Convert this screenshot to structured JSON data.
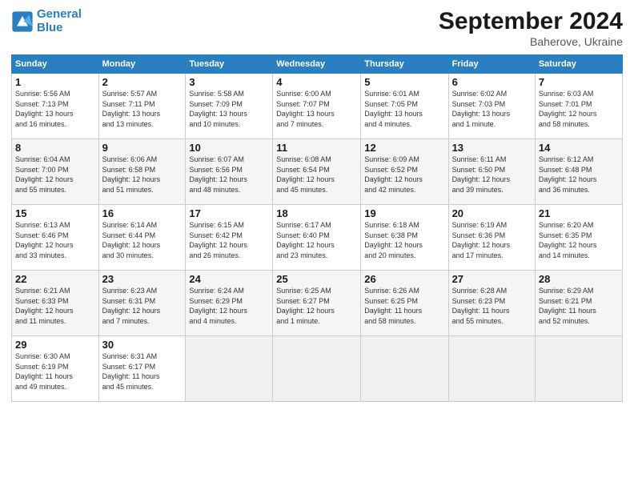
{
  "logo": {
    "line1": "General",
    "line2": "Blue"
  },
  "title": "September 2024",
  "subtitle": "Baherove, Ukraine",
  "days_header": [
    "Sunday",
    "Monday",
    "Tuesday",
    "Wednesday",
    "Thursday",
    "Friday",
    "Saturday"
  ],
  "weeks": [
    [
      {
        "num": "1",
        "info": "Sunrise: 5:56 AM\nSunset: 7:13 PM\nDaylight: 13 hours\nand 16 minutes."
      },
      {
        "num": "2",
        "info": "Sunrise: 5:57 AM\nSunset: 7:11 PM\nDaylight: 13 hours\nand 13 minutes."
      },
      {
        "num": "3",
        "info": "Sunrise: 5:58 AM\nSunset: 7:09 PM\nDaylight: 13 hours\nand 10 minutes."
      },
      {
        "num": "4",
        "info": "Sunrise: 6:00 AM\nSunset: 7:07 PM\nDaylight: 13 hours\nand 7 minutes."
      },
      {
        "num": "5",
        "info": "Sunrise: 6:01 AM\nSunset: 7:05 PM\nDaylight: 13 hours\nand 4 minutes."
      },
      {
        "num": "6",
        "info": "Sunrise: 6:02 AM\nSunset: 7:03 PM\nDaylight: 13 hours\nand 1 minute."
      },
      {
        "num": "7",
        "info": "Sunrise: 6:03 AM\nSunset: 7:01 PM\nDaylight: 12 hours\nand 58 minutes."
      }
    ],
    [
      {
        "num": "8",
        "info": "Sunrise: 6:04 AM\nSunset: 7:00 PM\nDaylight: 12 hours\nand 55 minutes."
      },
      {
        "num": "9",
        "info": "Sunrise: 6:06 AM\nSunset: 6:58 PM\nDaylight: 12 hours\nand 51 minutes."
      },
      {
        "num": "10",
        "info": "Sunrise: 6:07 AM\nSunset: 6:56 PM\nDaylight: 12 hours\nand 48 minutes."
      },
      {
        "num": "11",
        "info": "Sunrise: 6:08 AM\nSunset: 6:54 PM\nDaylight: 12 hours\nand 45 minutes."
      },
      {
        "num": "12",
        "info": "Sunrise: 6:09 AM\nSunset: 6:52 PM\nDaylight: 12 hours\nand 42 minutes."
      },
      {
        "num": "13",
        "info": "Sunrise: 6:11 AM\nSunset: 6:50 PM\nDaylight: 12 hours\nand 39 minutes."
      },
      {
        "num": "14",
        "info": "Sunrise: 6:12 AM\nSunset: 6:48 PM\nDaylight: 12 hours\nand 36 minutes."
      }
    ],
    [
      {
        "num": "15",
        "info": "Sunrise: 6:13 AM\nSunset: 6:46 PM\nDaylight: 12 hours\nand 33 minutes."
      },
      {
        "num": "16",
        "info": "Sunrise: 6:14 AM\nSunset: 6:44 PM\nDaylight: 12 hours\nand 30 minutes."
      },
      {
        "num": "17",
        "info": "Sunrise: 6:15 AM\nSunset: 6:42 PM\nDaylight: 12 hours\nand 26 minutes."
      },
      {
        "num": "18",
        "info": "Sunrise: 6:17 AM\nSunset: 6:40 PM\nDaylight: 12 hours\nand 23 minutes."
      },
      {
        "num": "19",
        "info": "Sunrise: 6:18 AM\nSunset: 6:38 PM\nDaylight: 12 hours\nand 20 minutes."
      },
      {
        "num": "20",
        "info": "Sunrise: 6:19 AM\nSunset: 6:36 PM\nDaylight: 12 hours\nand 17 minutes."
      },
      {
        "num": "21",
        "info": "Sunrise: 6:20 AM\nSunset: 6:35 PM\nDaylight: 12 hours\nand 14 minutes."
      }
    ],
    [
      {
        "num": "22",
        "info": "Sunrise: 6:21 AM\nSunset: 6:33 PM\nDaylight: 12 hours\nand 11 minutes."
      },
      {
        "num": "23",
        "info": "Sunrise: 6:23 AM\nSunset: 6:31 PM\nDaylight: 12 hours\nand 7 minutes."
      },
      {
        "num": "24",
        "info": "Sunrise: 6:24 AM\nSunset: 6:29 PM\nDaylight: 12 hours\nand 4 minutes."
      },
      {
        "num": "25",
        "info": "Sunrise: 6:25 AM\nSunset: 6:27 PM\nDaylight: 12 hours\nand 1 minute."
      },
      {
        "num": "26",
        "info": "Sunrise: 6:26 AM\nSunset: 6:25 PM\nDaylight: 11 hours\nand 58 minutes."
      },
      {
        "num": "27",
        "info": "Sunrise: 6:28 AM\nSunset: 6:23 PM\nDaylight: 11 hours\nand 55 minutes."
      },
      {
        "num": "28",
        "info": "Sunrise: 6:29 AM\nSunset: 6:21 PM\nDaylight: 11 hours\nand 52 minutes."
      }
    ],
    [
      {
        "num": "29",
        "info": "Sunrise: 6:30 AM\nSunset: 6:19 PM\nDaylight: 11 hours\nand 49 minutes."
      },
      {
        "num": "30",
        "info": "Sunrise: 6:31 AM\nSunset: 6:17 PM\nDaylight: 11 hours\nand 45 minutes."
      },
      {
        "num": "",
        "info": ""
      },
      {
        "num": "",
        "info": ""
      },
      {
        "num": "",
        "info": ""
      },
      {
        "num": "",
        "info": ""
      },
      {
        "num": "",
        "info": ""
      }
    ]
  ]
}
